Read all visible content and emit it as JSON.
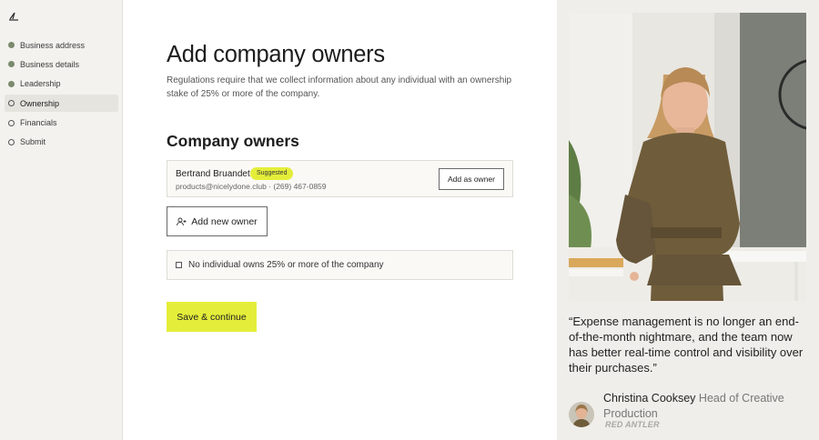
{
  "sidebar": {
    "items": [
      {
        "label": "Business address",
        "status": "done"
      },
      {
        "label": "Business details",
        "status": "done"
      },
      {
        "label": "Leadership",
        "status": "done"
      },
      {
        "label": "Ownership",
        "status": "current"
      },
      {
        "label": "Financials",
        "status": "todo"
      },
      {
        "label": "Submit",
        "status": "todo"
      }
    ]
  },
  "main": {
    "title": "Add company owners",
    "description": "Regulations require that we collect information about any individual with an ownership stake of 25% or more of the company.",
    "section_title": "Company owners",
    "suggested_owner": {
      "name": "Bertrand Bruandet",
      "badge": "Suggested",
      "contact": "products@nicelydone.club · (269) 467-0859",
      "button_label": "Add as owner"
    },
    "add_new_owner_label": "Add new owner",
    "checkbox_label": "No individual owns 25% or more of the company",
    "save_label": "Save & continue"
  },
  "testimonial": {
    "quote": "“Expense management is no longer an end-of-the-month nightmare, and the team now has better real-time control and visibility over their purchases.”",
    "author_name": "Christina Cooksey",
    "author_title": "Head of Creative Production",
    "company_logo_text": "RED ANTLER"
  },
  "colors": {
    "accent": "#e4ee3a",
    "sidebar_bg": "#f3f2ee",
    "done_dot": "#7b8a6c"
  }
}
